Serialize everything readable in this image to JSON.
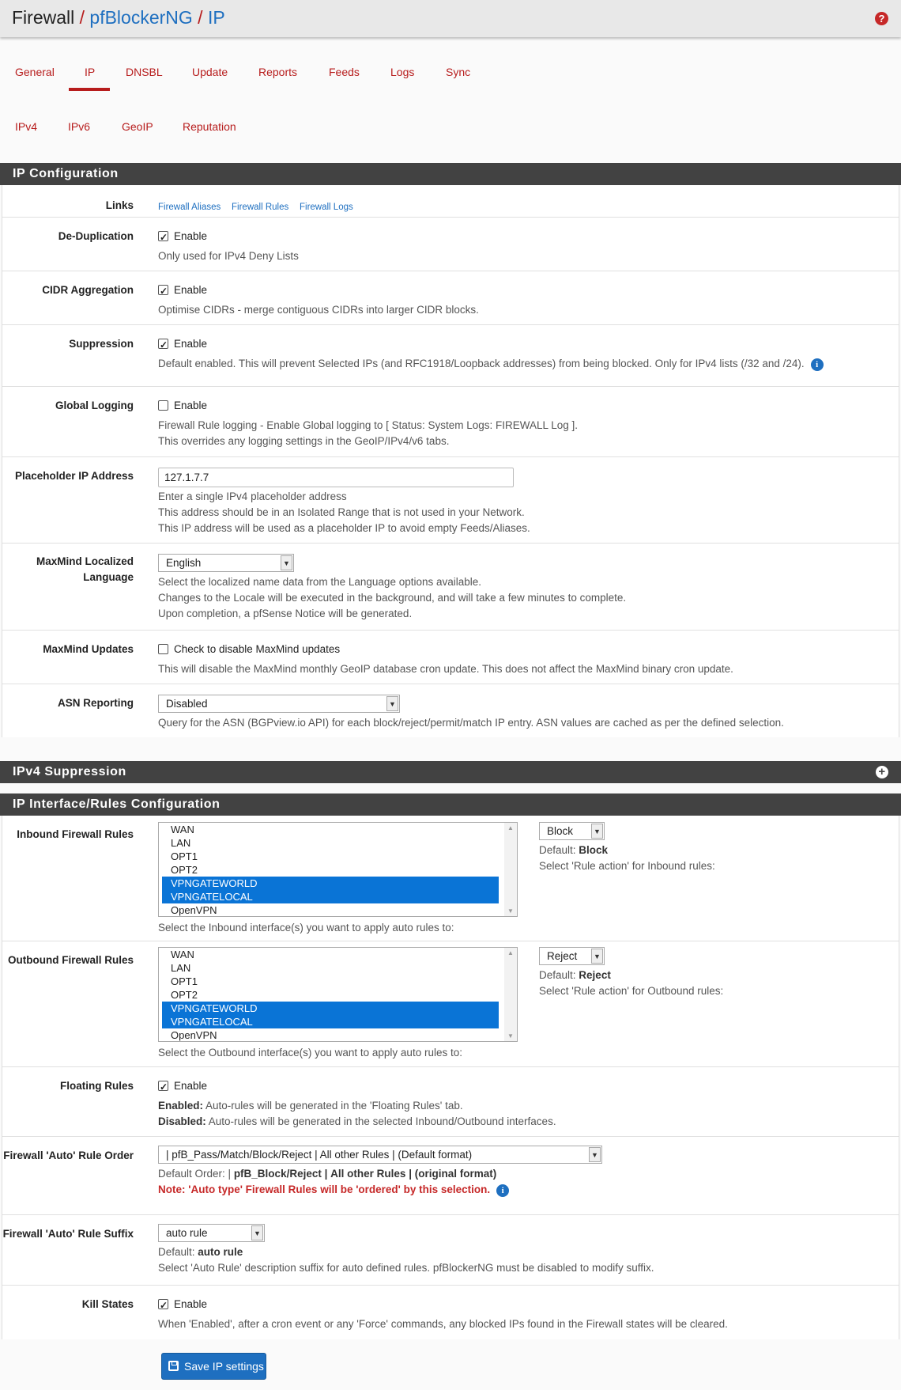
{
  "breadcrumb": {
    "root": "Firewall",
    "sep": "/",
    "level1": "pfBlockerNG",
    "level2": "IP"
  },
  "tabs": [
    "General",
    "IP",
    "DNSBL",
    "Update",
    "Reports",
    "Feeds",
    "Logs",
    "Sync"
  ],
  "active_tab": "IP",
  "subtabs": [
    "IPv4",
    "IPv6",
    "GeoIP",
    "Reputation"
  ],
  "sections": {
    "ip_config": "IP Configuration",
    "ipv4_suppression": "IPv4 Suppression",
    "interface_rules": "IP Interface/Rules Configuration"
  },
  "links": {
    "label": "Links",
    "items": [
      "Firewall Aliases",
      "Firewall Rules",
      "Firewall Logs"
    ]
  },
  "dedup": {
    "label": "De-Duplication",
    "checked": true,
    "check_label": "Enable",
    "help": "Only used for IPv4 Deny Lists"
  },
  "cidr": {
    "label": "CIDR Aggregation",
    "checked": true,
    "check_label": "Enable",
    "help": "Optimise CIDRs - merge contiguous CIDRs into larger CIDR blocks."
  },
  "suppression": {
    "label": "Suppression",
    "checked": true,
    "check_label": "Enable",
    "help": "Default enabled. This will prevent Selected IPs (and RFC1918/Loopback addresses) from being blocked. Only for IPv4 lists (/32 and /24)."
  },
  "global_logging": {
    "label": "Global Logging",
    "checked": false,
    "check_label": "Enable",
    "help1": "Firewall Rule logging - Enable Global logging to [ Status: System Logs: FIREWALL Log ].",
    "help2": "This overrides any logging settings in the GeoIP/IPv4/v6 tabs."
  },
  "placeholder": {
    "label": "Placeholder IP Address",
    "value": "127.1.7.7",
    "help1": "Enter a single IPv4 placeholder address",
    "help2": "This address should be in an Isolated Range that is not used in your Network.",
    "help3": "This IP address will be used as a placeholder IP to avoid empty Feeds/Aliases."
  },
  "maxmind_lang": {
    "label1": "MaxMind Localized",
    "label2": "Language",
    "value": "English",
    "help1": "Select the localized name data from the Language options available.",
    "help2": "Changes to the Locale will be executed in the background, and will take a few minutes to complete.",
    "help3": "Upon completion, a pfSense Notice will be generated."
  },
  "maxmind_updates": {
    "label": "MaxMind Updates",
    "checked": false,
    "check_label": "Check to disable MaxMind updates",
    "help": "This will disable the MaxMind monthly GeoIP database cron update. This does not affect the MaxMind binary cron update."
  },
  "asn": {
    "label": "ASN Reporting",
    "value": "Disabled",
    "help": "Query for the ASN (BGPview.io API) for each block/reject/permit/match IP entry. ASN values are cached as per the defined selection."
  },
  "inbound": {
    "label": "Inbound Firewall Rules",
    "interfaces": [
      {
        "name": "WAN",
        "selected": false
      },
      {
        "name": "LAN",
        "selected": false
      },
      {
        "name": "OPT1",
        "selected": false
      },
      {
        "name": "OPT2",
        "selected": false
      },
      {
        "name": "VPNGATEWORLD",
        "selected": true
      },
      {
        "name": "VPNGATELOCAL",
        "selected": true
      },
      {
        "name": "OpenVPN",
        "selected": false
      }
    ],
    "help": "Select the Inbound interface(s) you want to apply auto rules to:",
    "action": "Block",
    "default_prefix": "Default:",
    "default_value": "Block",
    "action_help": "Select 'Rule action' for Inbound rules:"
  },
  "outbound": {
    "label": "Outbound Firewall Rules",
    "interfaces": [
      {
        "name": "WAN",
        "selected": false
      },
      {
        "name": "LAN",
        "selected": false
      },
      {
        "name": "OPT1",
        "selected": false
      },
      {
        "name": "OPT2",
        "selected": false
      },
      {
        "name": "VPNGATEWORLD",
        "selected": true
      },
      {
        "name": "VPNGATELOCAL",
        "selected": true
      },
      {
        "name": "OpenVPN",
        "selected": false
      }
    ],
    "help": "Select the Outbound interface(s) you want to apply auto rules to:",
    "action": "Reject",
    "default_prefix": "Default:",
    "default_value": "Reject",
    "action_help": "Select 'Rule action' for Outbound rules:"
  },
  "floating": {
    "label": "Floating Rules",
    "checked": true,
    "check_label": "Enable",
    "enabled_b": "Enabled:",
    "enabled_t": "Auto-rules will be generated in the 'Floating Rules' tab.",
    "disabled_b": "Disabled:",
    "disabled_t": "Auto-rules will be generated in the selected Inbound/Outbound interfaces."
  },
  "rule_order": {
    "label": "Firewall 'Auto' Rule Order",
    "value": "| pfB_Pass/Match/Block/Reject | All other Rules | (Default format)",
    "default_prefix": "Default Order: |",
    "seg1": "pfB_Block/Reject",
    "seg2": "All other Rules",
    "seg3": "(original format)",
    "sep": "|",
    "note": "Note: 'Auto type' Firewall Rules will be 'ordered' by this selection."
  },
  "rule_suffix": {
    "label": "Firewall 'Auto' Rule Suffix",
    "value": "auto rule",
    "default_prefix": "Default:",
    "default_value": "auto rule",
    "help": "Select 'Auto Rule' description suffix for auto defined rules. pfBlockerNG must be disabled to modify suffix."
  },
  "kill_states": {
    "label": "Kill States",
    "checked": true,
    "check_label": "Enable",
    "help": "When 'Enabled', after a cron event or any 'Force' commands, any blocked IPs found in the Firewall states will be cleared."
  },
  "save_label": "Save IP settings"
}
